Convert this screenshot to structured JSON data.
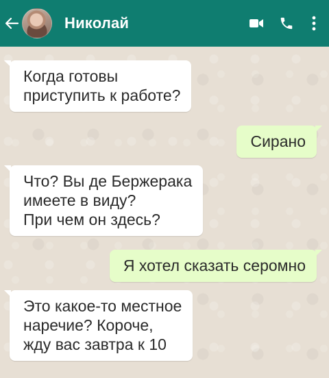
{
  "header": {
    "contact_name": "Николай",
    "back_icon": "arrow-left-icon",
    "video_icon": "video-camera-icon",
    "call_icon": "phone-icon",
    "menu_icon": "more-vertical-icon",
    "color": "#0f7d70"
  },
  "messages": [
    {
      "direction": "incoming",
      "lines": [
        "Когда готовы",
        "приступить к работе?"
      ]
    },
    {
      "direction": "outgoing",
      "lines": [
        "Сирано"
      ]
    },
    {
      "direction": "incoming",
      "lines": [
        "Что? Вы де Бержерака",
        "имеете в виду?",
        "При чем он здесь?"
      ]
    },
    {
      "direction": "outgoing",
      "lines": [
        "Я хотел сказать серомно"
      ]
    },
    {
      "direction": "incoming",
      "lines": [
        "Это какое-то местное",
        "наречие? Короче,",
        "жду вас завтра к 10"
      ]
    }
  ],
  "colors": {
    "incoming_bubble": "#ffffff",
    "outgoing_bubble": "#e6fdc9",
    "chat_background": "#e7dfd4"
  }
}
